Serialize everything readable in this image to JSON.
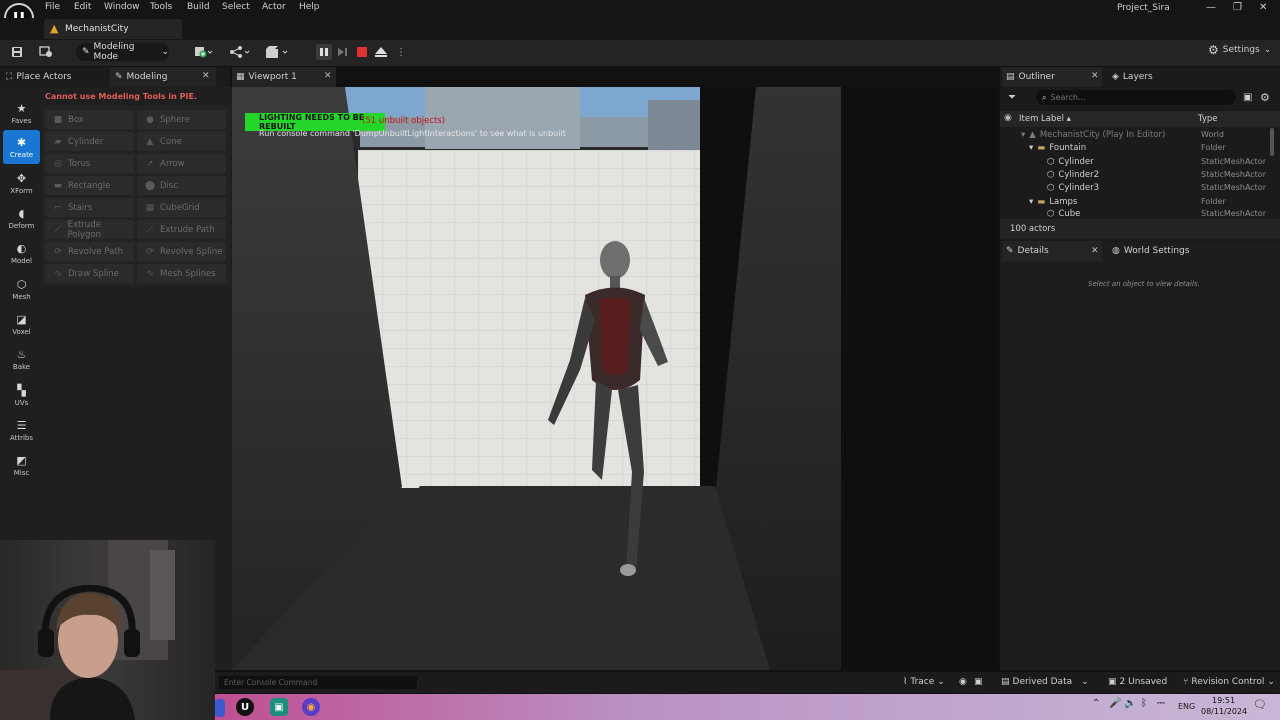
{
  "menu": {
    "logo": "U",
    "items": [
      "File",
      "Edit",
      "Window",
      "Tools",
      "Build",
      "Select",
      "Actor",
      "Help"
    ],
    "project": "Project_Sira",
    "minimize": "—",
    "maximize": "❐",
    "close": "✕"
  },
  "level_tab": {
    "name": "MechanistCity"
  },
  "toolbar": {
    "mode_label": "Modeling Mode",
    "settings_label": "Settings"
  },
  "left_tabs": {
    "place_actors": "Place Actors",
    "modeling": "Modeling",
    "viewport": "Viewport 1"
  },
  "categories": [
    {
      "label": "Faves",
      "icon": "star-icon"
    },
    {
      "label": "Create",
      "icon": "create-icon"
    },
    {
      "label": "XForm",
      "icon": "xform-icon"
    },
    {
      "label": "Deform",
      "icon": "deform-icon"
    },
    {
      "label": "Model",
      "icon": "model-icon"
    },
    {
      "label": "Mesh",
      "icon": "mesh-icon"
    },
    {
      "label": "Voxel",
      "icon": "voxel-icon"
    },
    {
      "label": "Bake",
      "icon": "bake-icon"
    },
    {
      "label": "UVs",
      "icon": "uvs-icon"
    },
    {
      "label": "Attribs",
      "icon": "attribs-icon"
    },
    {
      "label": "Misc",
      "icon": "misc-icon"
    }
  ],
  "warning": "Cannot use Modeling Tools in PIE.",
  "tools": [
    {
      "label": "Box"
    },
    {
      "label": "Sphere"
    },
    {
      "label": "Cylinder"
    },
    {
      "label": "Cone"
    },
    {
      "label": "Torus"
    },
    {
      "label": "Arrow"
    },
    {
      "label": "Rectangle"
    },
    {
      "label": "Disc"
    },
    {
      "label": "Stairs"
    },
    {
      "label": "CubeGrid"
    },
    {
      "label": "Extrude Polygon"
    },
    {
      "label": "Extrude Path"
    },
    {
      "label": "Revolve Path"
    },
    {
      "label": "Revolve Spline"
    },
    {
      "label": "Draw Spline"
    },
    {
      "label": "Mesh Splines"
    }
  ],
  "viewport": {
    "lighting_banner": "LIGHTING NEEDS TO BE REBUILT",
    "lighting_extra": "(51 unbuilt objects)",
    "console_msg": "Run console command 'DumpUnbuiltLightInteractions' to see what is unbuilt"
  },
  "outliner": {
    "tab": "Outliner",
    "layers_tab": "Layers",
    "search_placeholder": "Search...",
    "col_label": "Item Label ▴",
    "col_type": "Type",
    "rows": [
      {
        "label": "MechanistCity (Play In Editor)",
        "type": "World"
      },
      {
        "label": "Fountain",
        "type": "Folder"
      },
      {
        "label": "Cylinder",
        "type": "StaticMeshActor"
      },
      {
        "label": "Cylinder2",
        "type": "StaticMeshActor"
      },
      {
        "label": "Cylinder3",
        "type": "StaticMeshActor"
      },
      {
        "label": "Lamps",
        "type": "Folder"
      },
      {
        "label": "Cube",
        "type": "StaticMeshActor"
      }
    ],
    "actors_count": "100 actors"
  },
  "details": {
    "tab": "Details",
    "world_settings_tab": "World Settings",
    "empty_msg": "Select an object to view details."
  },
  "bottom": {
    "console_placeholder": "Enter Console Command",
    "trace": "Trace",
    "derived_data": "Derived Data",
    "unsaved": "2 Unsaved",
    "revision": "Revision Control"
  },
  "taskbar": {
    "lang": "ENG",
    "time": "19:51",
    "date": "08/11/2024"
  }
}
